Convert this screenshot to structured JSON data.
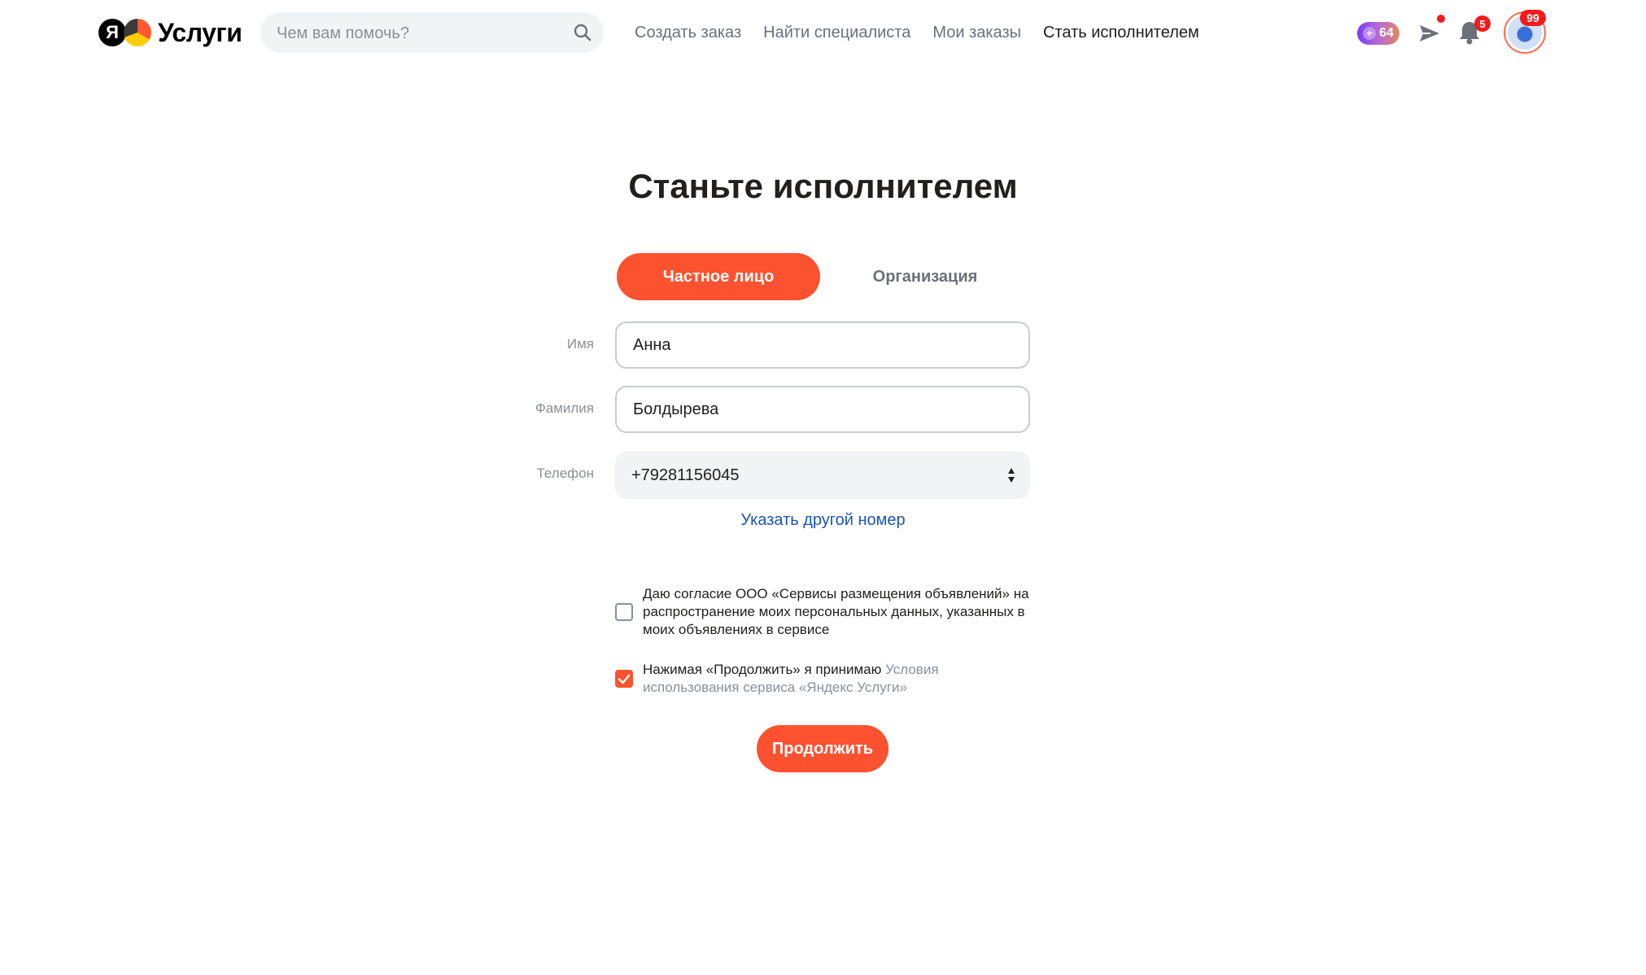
{
  "header": {
    "logo_letter": "Я",
    "logo_text": "Услуги",
    "search": {
      "placeholder": "Чем вам помочь?",
      "value": ""
    },
    "nav": [
      {
        "label": "Создать заказ",
        "active": false
      },
      {
        "label": "Найти специалиста",
        "active": false
      },
      {
        "label": "Мои заказы",
        "active": false
      },
      {
        "label": "Стать исполнителем",
        "active": true
      }
    ],
    "plus_points": "64",
    "notifications_count": "5",
    "profile_badge": "99",
    "icons": [
      "search-icon",
      "plus-icon",
      "send-icon",
      "bell-icon",
      "avatar"
    ]
  },
  "form": {
    "title": "Станьте исполнителем",
    "tabs": {
      "private": "Частное лицо",
      "organization": "Организация",
      "selected": "private"
    },
    "fields": {
      "first_name": {
        "label": "Имя",
        "value": "Анна"
      },
      "last_name": {
        "label": "Фамилия",
        "value": "Болдырева"
      },
      "phone": {
        "label": "Телефон",
        "value": "+79281156045"
      }
    },
    "other_phone_link": "Указать другой номер",
    "consent": {
      "checked": false,
      "text": "Даю согласие ООО «Сервисы размещения объявлений» на распространение моих персональных данных, указанных в моих объявлениях в сервисе"
    },
    "terms": {
      "checked": true,
      "text": "Нажимая «Продолжить» я принимаю ",
      "link": "Условия использования сервиса «Яндекс Услуги»"
    },
    "continue_label": "Продолжить"
  },
  "colors": {
    "accent": "#fc5230",
    "link": "#1a55b9",
    "muted": "#8b8f97",
    "badge": "#f21b1b"
  }
}
